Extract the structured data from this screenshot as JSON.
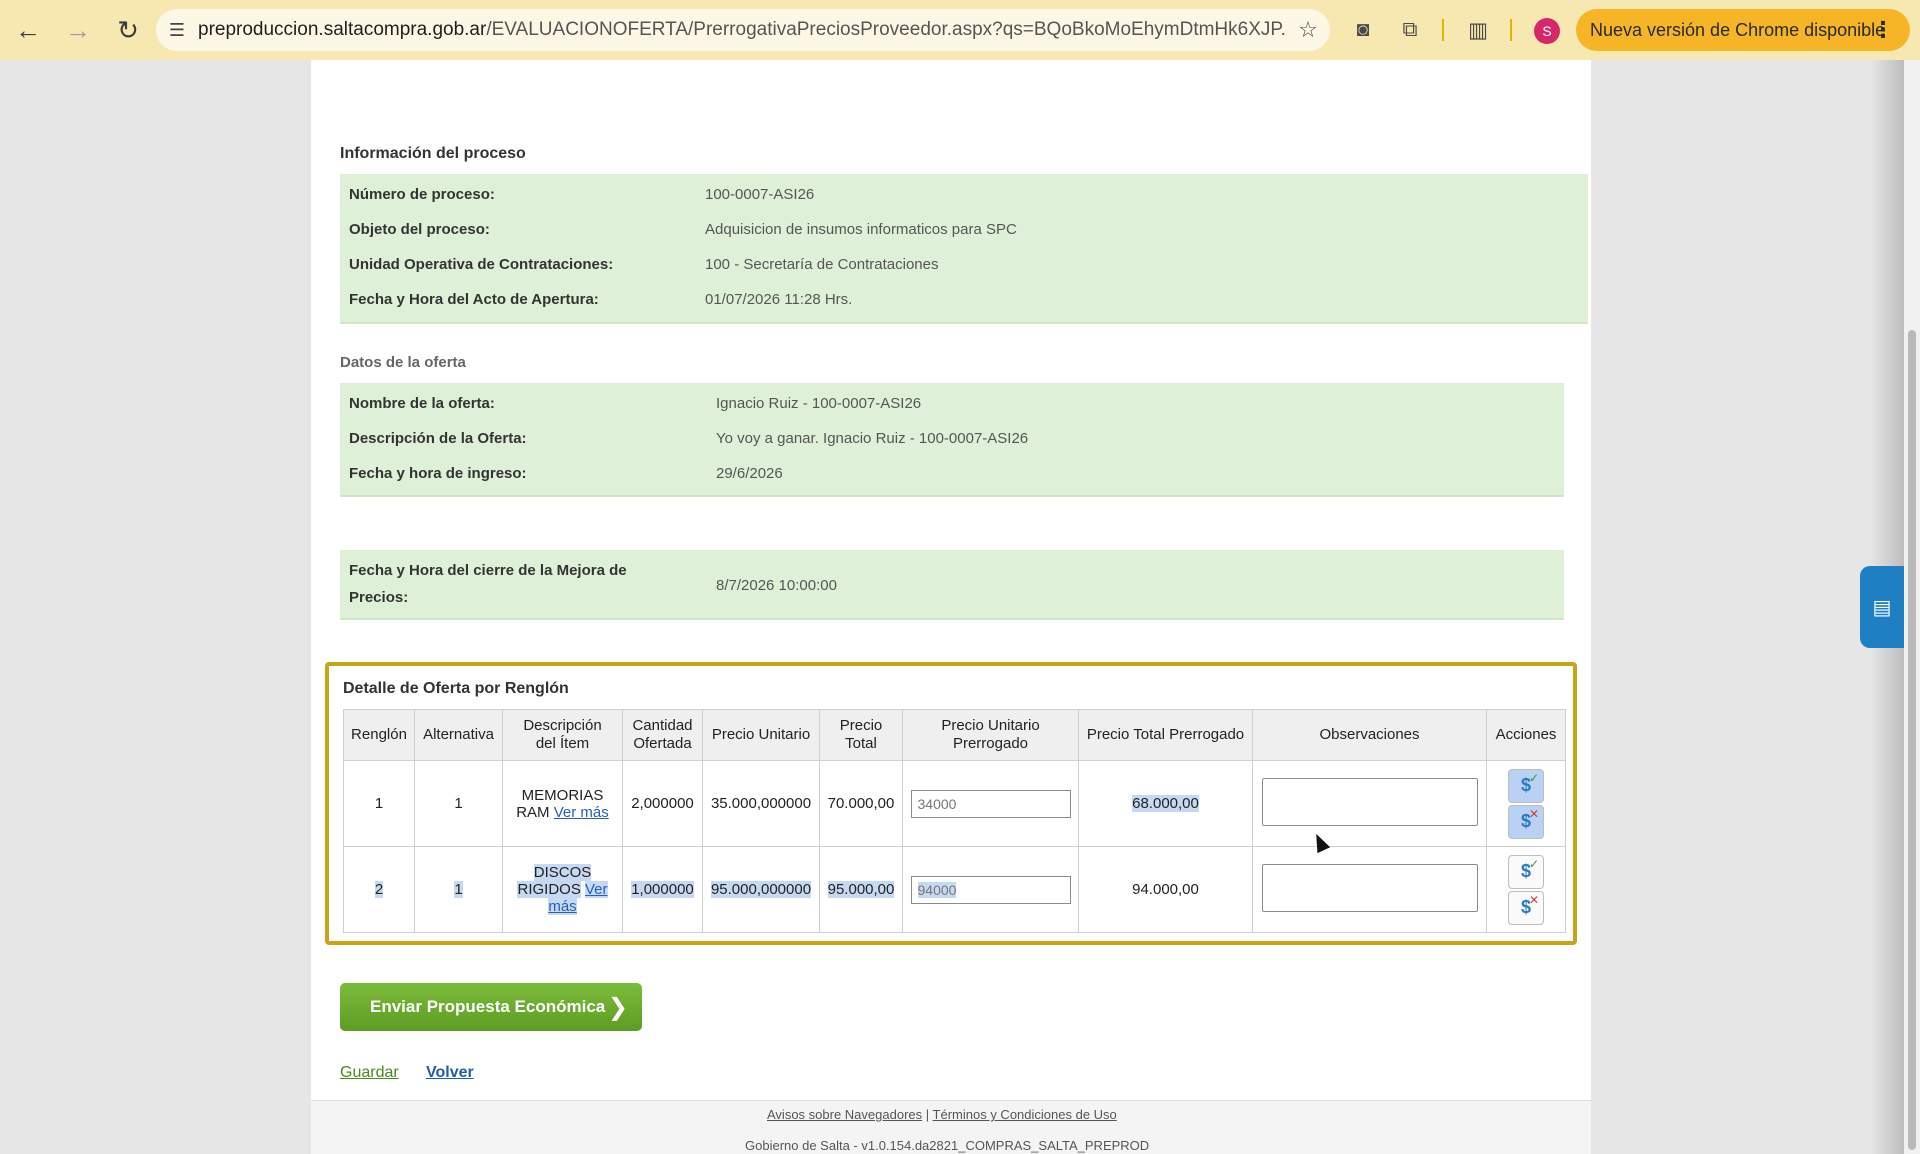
{
  "browser": {
    "url_host": "preproduccion.saltacompra.gob.ar",
    "url_path": "/EVALUACIONOFERTA/PrerrogativaPreciosProveedor.aspx?qs=BQoBkoMoEhymDtmHk6XJP...",
    "profile_initial": "S",
    "update_label": "Nueva versión de Chrome disponible"
  },
  "process_info": {
    "title": "Información del proceso",
    "rows": [
      {
        "label": "Número de proceso:",
        "value": "100-0007-ASI26"
      },
      {
        "label": "Objeto del proceso:",
        "value": "Adquisicion de insumos informaticos para SPC"
      },
      {
        "label": "Unidad Operativa de Contrataciones:",
        "value": "100 - Secretaría de Contrataciones"
      },
      {
        "label": "Fecha y Hora del Acto de Apertura:",
        "value": "01/07/2026 11:28 Hrs."
      }
    ]
  },
  "offer_info": {
    "title": "Datos de la oferta",
    "rows": [
      {
        "label": "Nombre de la oferta:",
        "value": "Ignacio Ruiz - 100-0007-ASI26"
      },
      {
        "label": "Descripción de la Oferta:",
        "value": "Yo voy a ganar. Ignacio Ruiz - 100-0007-ASI26"
      },
      {
        "label": "Fecha y hora de ingreso:",
        "value": "29/6/2026"
      }
    ]
  },
  "closing": {
    "label_line1": "Fecha y Hora del cierre de la Mejora de",
    "label_line2": "Precios:",
    "value": "8/7/2026 10:00:00"
  },
  "detail": {
    "title": "Detalle de Oferta por Renglón",
    "headers": {
      "renglon": "Renglón",
      "alternativa": "Alternativa",
      "descripcion_1": "Descripción",
      "descripcion_2": "del Ítem",
      "cantidad_1": "Cantidad",
      "cantidad_2": "Ofertada",
      "precio_unitario": "Precio Unitario",
      "precio_total_1": "Precio",
      "precio_total_2": "Total",
      "pu_prerrogado_1": "Precio Unitario",
      "pu_prerrogado_2": "Prerrogado",
      "pt_prerrogado": "Precio Total Prerrogado",
      "observaciones": "Observaciones",
      "acciones": "Acciones"
    },
    "rows": [
      {
        "renglon": "1",
        "alternativa": "1",
        "desc_1": "MEMORIAS",
        "desc_2": "RAM",
        "ver_mas_1": "Ver más",
        "ver_mas_2": "",
        "cantidad": "2,000000",
        "precio_unitario": "35.000,000000",
        "precio_total": "70.000,00",
        "pu_prerrogado": "34000",
        "pt_prerrogado": "68.000,00",
        "observaciones": ""
      },
      {
        "renglon": "2",
        "alternativa": "1",
        "desc_1": "DISCOS",
        "desc_2": "RIGIDOS",
        "ver_mas_1": "Ver",
        "ver_mas_2": "más",
        "cantidad": "1,000000",
        "precio_unitario": "95.000,000000",
        "precio_total": "95.000,00",
        "pu_prerrogado": "94000",
        "pt_prerrogado": "94.000,00",
        "observaciones": ""
      }
    ]
  },
  "actions": {
    "send_label": "Enviar Propuesta Económica",
    "save_label": "Guardar",
    "back_label": "Volver"
  },
  "footer": {
    "browsers_link": "Avisos sobre Navegadores",
    "separator": "|",
    "terms_link": "Términos y Condiciones de Uso",
    "version": "Gobierno de Salta - v1.0.154.da2821_COMPRAS_SALTA_PREPROD"
  },
  "colors": {
    "info_green": "#dff0d8",
    "highlight_border": "#c9a318",
    "primary_green": "#6aa82f",
    "selection_blue": "#c7d8f3"
  }
}
